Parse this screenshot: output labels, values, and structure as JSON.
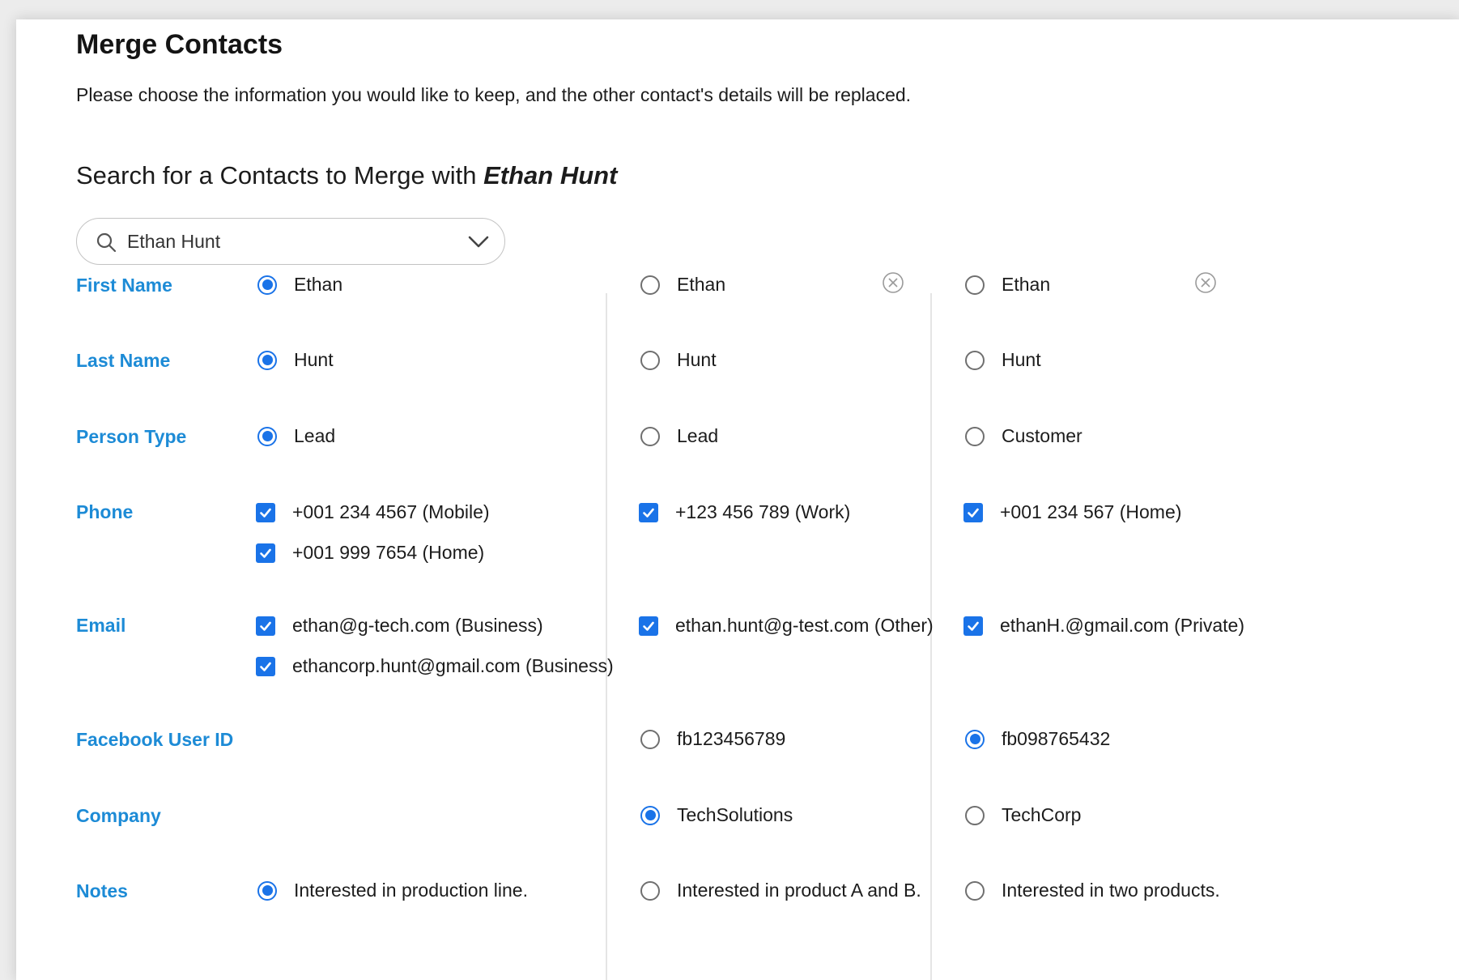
{
  "header": {
    "title": "Merge Contacts",
    "description": "Please choose the information you would like to keep, and the other contact's details will be replaced.",
    "search_heading_prefix": "Search for a Contacts to Merge with ",
    "search_heading_name": "Ethan Hunt"
  },
  "search": {
    "value": "Ethan Hunt",
    "icon": "search-icon",
    "dropdown_icon": "chevron-down-icon"
  },
  "colors": {
    "accent": "#1a73e8",
    "label": "#1d8bd6",
    "text": "#1c1c1c"
  },
  "fields": {
    "first_name": {
      "label": "First Name",
      "col1": {
        "value": "Ethan",
        "selected": true
      },
      "col2": {
        "value": "Ethan",
        "selected": false
      },
      "col3": {
        "value": "Ethan",
        "selected": false
      }
    },
    "last_name": {
      "label": "Last Name",
      "col1": {
        "value": "Hunt",
        "selected": true
      },
      "col2": {
        "value": "Hunt",
        "selected": false
      },
      "col3": {
        "value": "Hunt",
        "selected": false
      }
    },
    "person_type": {
      "label": "Person Type",
      "col1": {
        "value": "Lead",
        "selected": true
      },
      "col2": {
        "value": "Lead",
        "selected": false
      },
      "col3": {
        "value": "Customer",
        "selected": false
      }
    },
    "phone": {
      "label": "Phone",
      "col1": [
        {
          "value": "+001 234 4567 (Mobile)",
          "checked": true
        },
        {
          "value": "+001 999 7654 (Home)",
          "checked": true
        }
      ],
      "col2": [
        {
          "value": "+123 456 789 (Work)",
          "checked": true
        }
      ],
      "col3": [
        {
          "value": "+001 234 567 (Home)",
          "checked": true
        }
      ]
    },
    "email": {
      "label": "Email",
      "col1": [
        {
          "value": "ethan@g-tech.com (Business)",
          "checked": true
        },
        {
          "value": "ethancorp.hunt@gmail.com (Business)",
          "checked": true
        }
      ],
      "col2": [
        {
          "value": "ethan.hunt@g-test.com (Other)",
          "checked": true
        }
      ],
      "col3": [
        {
          "value": "ethanH.@gmail.com (Private)",
          "checked": true
        }
      ]
    },
    "facebook": {
      "label": "Facebook User ID",
      "col2": {
        "value": "fb123456789",
        "selected": false
      },
      "col3": {
        "value": "fb098765432",
        "selected": true
      }
    },
    "company": {
      "label": "Company",
      "col2": {
        "value": "TechSolutions",
        "selected": true
      },
      "col3": {
        "value": "TechCorp",
        "selected": false
      }
    },
    "notes": {
      "label": "Notes",
      "col1": {
        "value": "Interested in production line.",
        "selected": true
      },
      "col2": {
        "value": "Interested in product A and B.",
        "selected": false
      },
      "col3": {
        "value": "Interested in two products.",
        "selected": false
      }
    }
  },
  "remove_contact_icon": "close-circle-icon"
}
